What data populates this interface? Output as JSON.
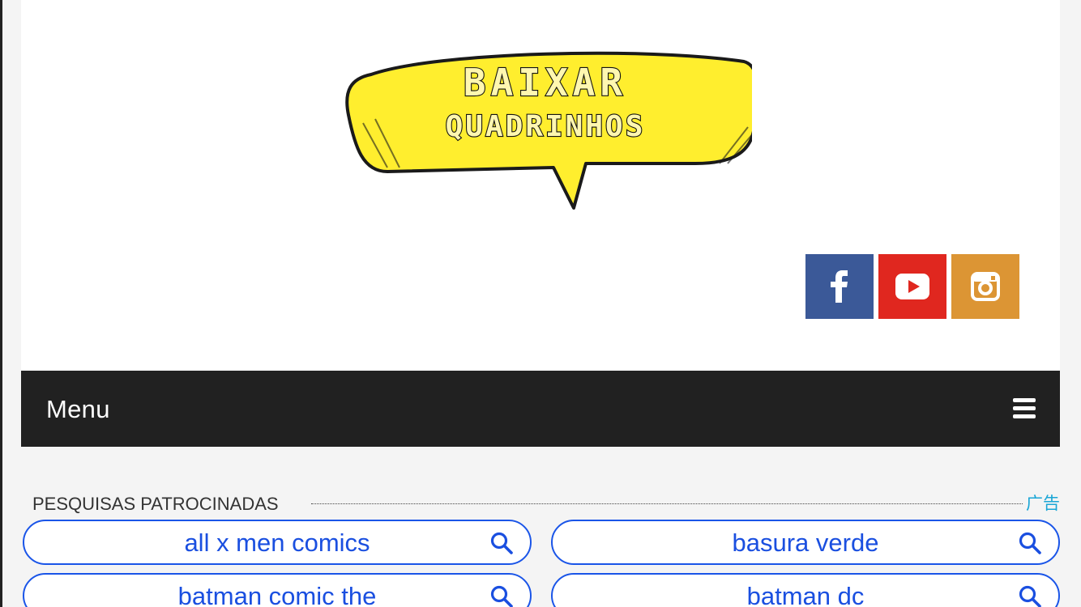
{
  "logo": {
    "line1": "BAIXAR",
    "line2": "QUADRINHOS",
    "fill_color": "#ffee2e"
  },
  "social": [
    {
      "name": "facebook",
      "icon": "facebook-icon",
      "color": "#3b5998"
    },
    {
      "name": "youtube",
      "icon": "youtube-icon",
      "color": "#e0271f"
    },
    {
      "name": "instagram",
      "icon": "instagram-icon",
      "color": "#dc9534"
    }
  ],
  "nav": {
    "menu_label": "Menu",
    "icon": "hamburger-icon",
    "background": "#212121"
  },
  "ads": {
    "title": "PESQUISAS PATROCINADAS",
    "mark": "广告",
    "items": [
      {
        "label": "all x men comics"
      },
      {
        "label": "basura verde"
      },
      {
        "label": "batman comic the"
      },
      {
        "label": "batman dc"
      }
    ],
    "accent": "#1a55e8"
  }
}
